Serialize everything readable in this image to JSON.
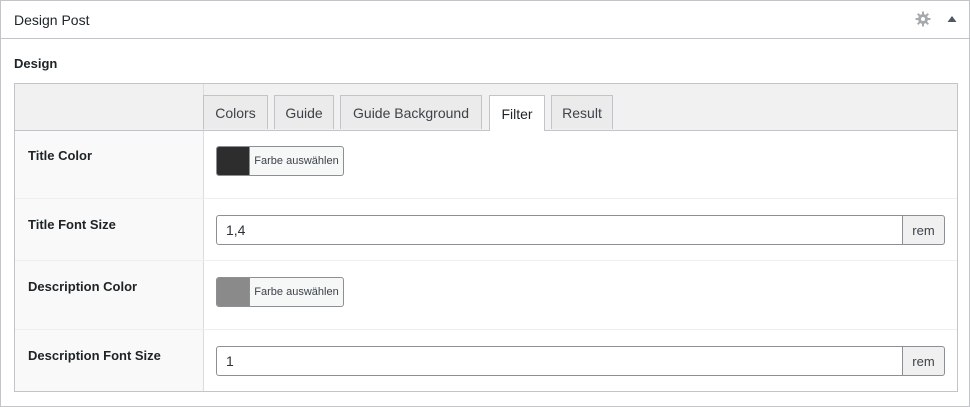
{
  "panel": {
    "title": "Design Post",
    "icons": [
      "gear-icon",
      "caret-up-icon"
    ]
  },
  "section": {
    "title": "Design"
  },
  "tabs": [
    {
      "label": "Colors",
      "active": false
    },
    {
      "label": "Guide",
      "active": false
    },
    {
      "label": "Guide Background",
      "active": false
    },
    {
      "label": "Filter",
      "active": true
    },
    {
      "label": "Result",
      "active": false
    }
  ],
  "fields": {
    "title_color": {
      "label": "Title Color",
      "button_label": "Farbe auswählen",
      "swatch_color": "#2d2d2d"
    },
    "title_font_size": {
      "label": "Title Font Size",
      "value": "1,4",
      "unit": "rem"
    },
    "description_color": {
      "label": "Description Color",
      "button_label": "Farbe auswählen",
      "swatch_color": "#8a8a8a"
    },
    "description_font_size": {
      "label": "Description Font Size",
      "value": "1",
      "unit": "rem"
    }
  }
}
